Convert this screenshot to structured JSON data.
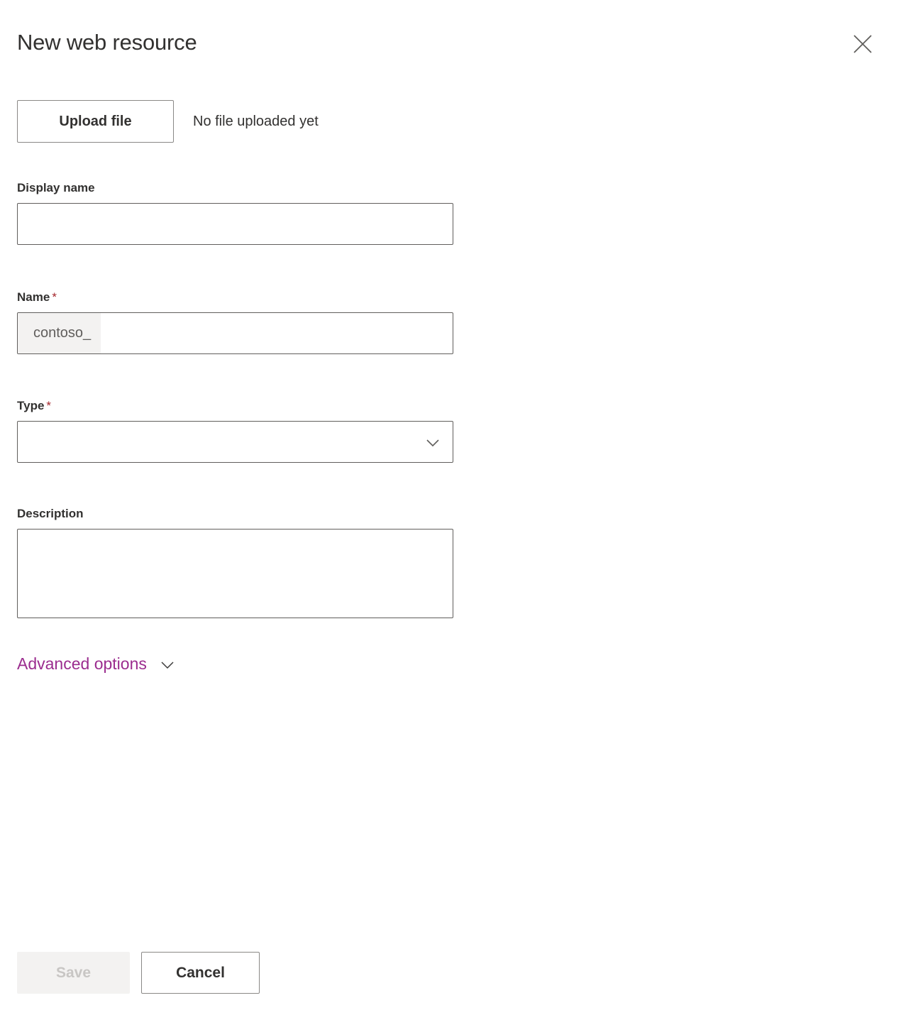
{
  "header": {
    "title": "New web resource",
    "close_icon": "close-icon"
  },
  "upload": {
    "button_label": "Upload file",
    "status_text": "No file uploaded yet"
  },
  "fields": {
    "display_name": {
      "label": "Display name",
      "value": "",
      "placeholder": ""
    },
    "name": {
      "label": "Name",
      "required_marker": "*",
      "prefix": "contoso_",
      "value": "",
      "placeholder": ""
    },
    "type": {
      "label": "Type",
      "required_marker": "*",
      "value": "",
      "chevron_icon": "chevron-down-icon"
    },
    "description": {
      "label": "Description",
      "value": "",
      "placeholder": ""
    }
  },
  "advanced": {
    "label": "Advanced options",
    "chevron_icon": "chevron-down-icon"
  },
  "footer": {
    "save_label": "Save",
    "cancel_label": "Cancel"
  },
  "colors": {
    "accent_link": "#9b2d8f",
    "required_star": "#a4262c",
    "text_primary": "#323130",
    "border": "#605e5c",
    "button_border": "#8a8886",
    "disabled_bg": "#f3f2f1",
    "disabled_text": "#c8c6c4",
    "prefix_bg": "#f3f2f1"
  }
}
